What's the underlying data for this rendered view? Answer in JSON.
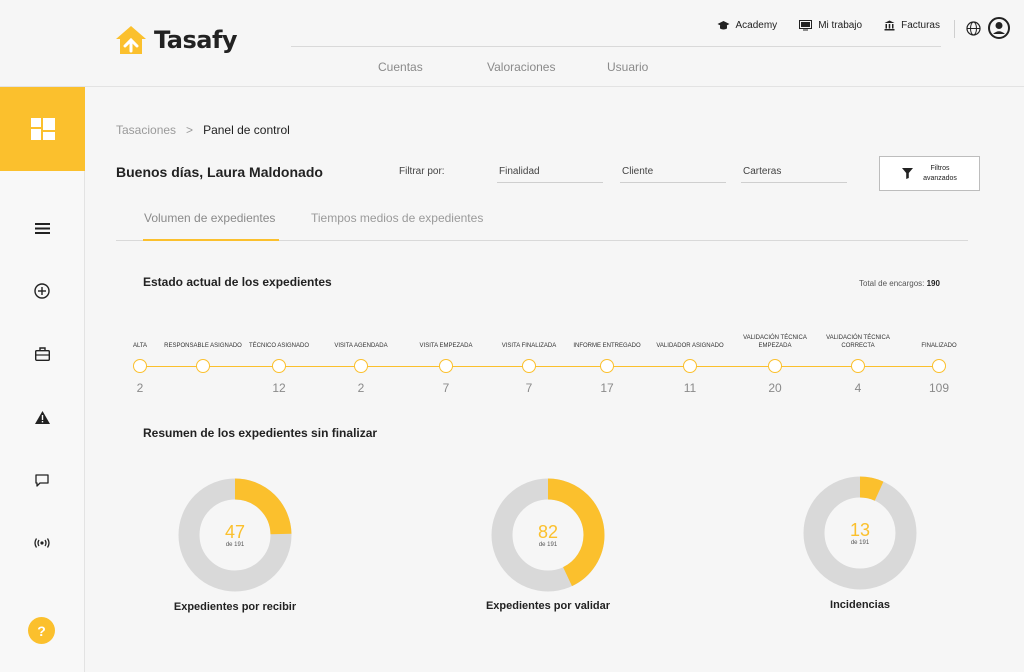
{
  "brand": {
    "name": "Tasafy",
    "accent": "#fbc02d"
  },
  "topnav": [
    {
      "label": "Academy",
      "icon": "graduation-cap-icon"
    },
    {
      "label": "Mi trabajo",
      "icon": "monitor-icon"
    },
    {
      "label": "Facturas",
      "icon": "bank-icon"
    }
  ],
  "mainnav": [
    "Cuentas",
    "Valoraciones",
    "Usuario"
  ],
  "breadcrumb": {
    "root": "Tasaciones",
    "sep": ">",
    "current": "Panel de control"
  },
  "greeting": "Buenos días, Laura Maldonado",
  "filters": {
    "label": "Filtrar por:",
    "fields": [
      "Finalidad",
      "Cliente",
      "Carteras"
    ],
    "advanced_line1": "Filtros",
    "advanced_line2": "avanzados"
  },
  "tabs": [
    "Volumen de expedientes",
    "Tiempos medios de expedientes"
  ],
  "status": {
    "title": "Estado actual de los expedientes",
    "total_label": "Total de encargos:",
    "total_value": "190",
    "stages": [
      {
        "label": "ALTA",
        "value": "2"
      },
      {
        "label": "RESPONSABLE ASIGNADO",
        "value": ""
      },
      {
        "label": "TÉCNICO ASIGNADO",
        "value": "12"
      },
      {
        "label": "VISITA AGENDADA",
        "value": "2"
      },
      {
        "label": "VISITA EMPEZADA",
        "value": "7"
      },
      {
        "label": "VISITA FINALIZADA",
        "value": "7"
      },
      {
        "label": "INFORME ENTREGADO",
        "value": "17"
      },
      {
        "label": "VALIDADOR ASIGNADO",
        "value": "11"
      },
      {
        "label": "VALIDACIÓN TÉCNICA EMPEZADA",
        "value": "20"
      },
      {
        "label": "VALIDACIÓN TÉCNICA CORRECTA",
        "value": "4"
      },
      {
        "label": "FINALIZADO",
        "value": "109"
      }
    ]
  },
  "summary": {
    "title": "Resumen de los expedientes sin finalizar",
    "total_text": "de 191",
    "donuts": [
      {
        "value": 47,
        "value_text": "47",
        "total": 191,
        "label": "Expedientes por recibir"
      },
      {
        "value": 82,
        "value_text": "82",
        "total": 191,
        "label": "Expedientes por validar"
      },
      {
        "value": 13,
        "value_text": "13",
        "total": 191,
        "label": "Incidencias"
      }
    ]
  },
  "help": {
    "label": "?"
  },
  "colors": {
    "accent": "#fbc02d",
    "ring_bg": "#d9d9d9"
  }
}
